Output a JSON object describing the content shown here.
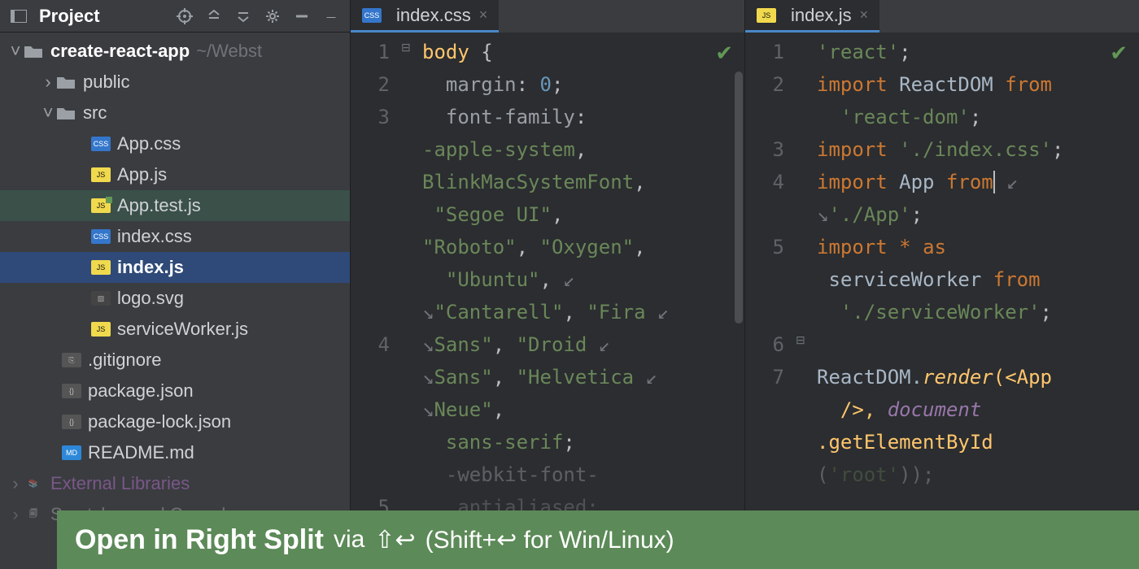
{
  "sidebar": {
    "title": "Project",
    "root": {
      "name": "create-react-app",
      "path": "~/Webst"
    },
    "public": "public",
    "src": "src",
    "files": {
      "appcss": "App.css",
      "appjs": "App.js",
      "apptest": "App.test.js",
      "indexcss": "index.css",
      "indexjs": "index.js",
      "logo": "logo.svg",
      "sw": "serviceWorker.js",
      "gitignore": ".gitignore",
      "pkg": "package.json",
      "pkglock": "package-lock.json",
      "readme": "README.md"
    },
    "ext": "External Libraries",
    "scratch": "Scratches and Consoles"
  },
  "tabs": {
    "css": "index.css",
    "js": "index.js"
  },
  "gutters": {
    "css": [
      "1",
      "2",
      "3",
      "4",
      "5"
    ],
    "js": [
      "1",
      "2",
      "3",
      "4",
      "5",
      "6",
      "7"
    ]
  },
  "css": {
    "l1a": "body",
    "l1b": " {",
    "l2a": "  margin",
    "l2b": ": ",
    "l2c": "0",
    "l2d": ";",
    "l3a": "  font-family",
    "l3b": ":",
    "l3c": "-apple-system",
    "l3d": ",",
    "l3e": "BlinkMacSystemFont",
    "l3f": ",",
    "l3g": " \"Segoe UI\"",
    "l3h": ",",
    "l3i": "\"Roboto\"",
    "l3j": ", ",
    "l3k": "\"Oxygen\"",
    "l3l": ",",
    "l4a": "  \"Ubuntu\"",
    "l4b": ",",
    "l4c": "\"Cantarell\"",
    "l4d": ", ",
    "l4e": "\"Fira",
    "l4f": "Sans\"",
    "l4g": ", ",
    "l4h": "\"Droid",
    "l4i": "Sans\"",
    "l4j": ", ",
    "l4k": "\"Helvetica",
    "l4l": "Neue\"",
    "l4m": ",",
    "l5a": "  sans-serif",
    "l5b": ";",
    "l6a": "  -webkit-font-",
    "l7a": "   antialiased;"
  },
  "js": {
    "l1a": "'react'",
    "l1b": ";",
    "l2a": "import",
    "l2b": " ReactDOM ",
    "l2c": "from",
    "l2d": "'react-dom'",
    "l2e": ";",
    "l3a": "import",
    "l3b": " ",
    "l3c": "'./index.css'",
    "l3d": ";",
    "l4a": "import",
    "l4b": " App ",
    "l4c": "from",
    "l4d": "'./App'",
    "l4e": ";",
    "l5a": "import",
    "l5b": " ",
    "l5c": "*",
    "l5d": " ",
    "l5e": "as",
    "l5f": " serviceWorker ",
    "l5g": "from",
    "l5h": "'./serviceWorker'",
    "l5i": ";",
    "l7a": "ReactDOM.",
    "l7b": "render",
    "l7c": "(<App",
    "l7d": "  />, ",
    "l7e": "document",
    "l7f": ".getElementById",
    "l7g": "(",
    "l7h": "'root'",
    "l7i": "));"
  },
  "banner": {
    "h": "Open in Right Split",
    "via": " via ",
    "k1": "⇧↩",
    "k2": " (Shift+↩ for Win/Linux)"
  }
}
